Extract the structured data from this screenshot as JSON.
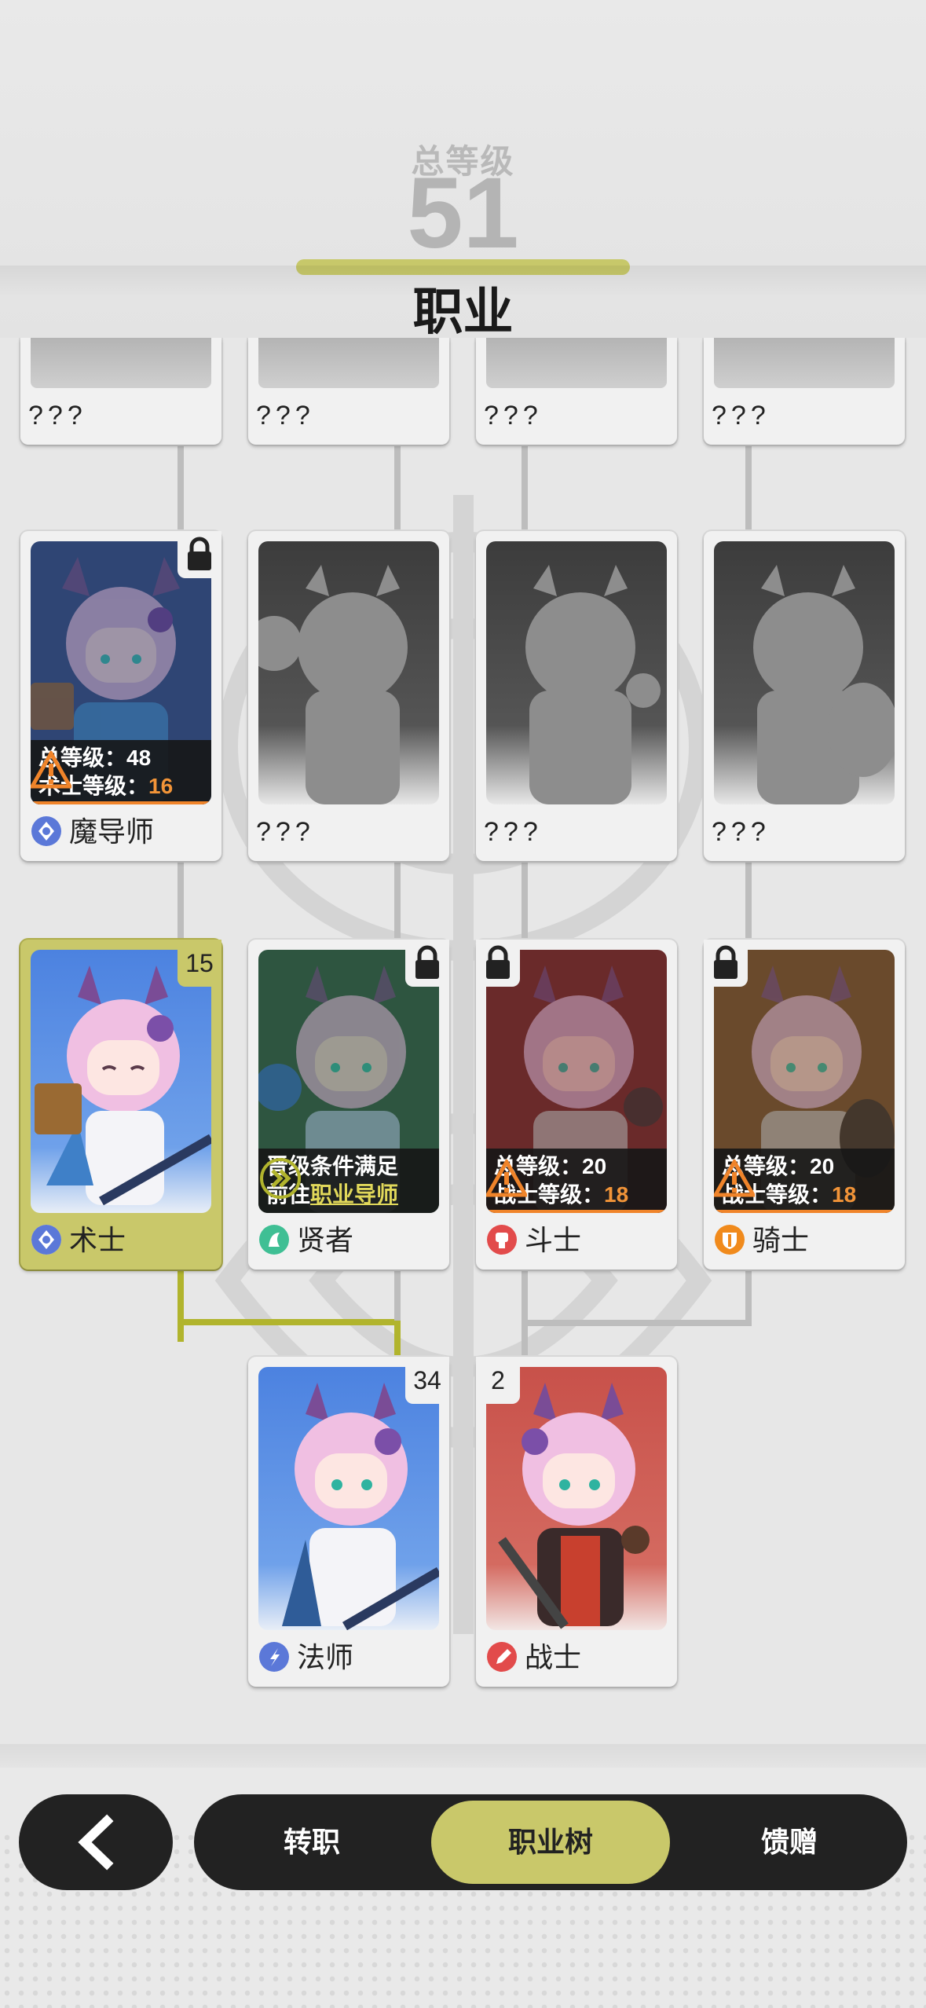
{
  "header": {
    "total_level_label": "总等级",
    "total_level_value": "51",
    "title": "职业"
  },
  "tree": {
    "top_row": [
      {
        "name": "???"
      },
      {
        "name": "???"
      },
      {
        "name": "???"
      },
      {
        "name": "???"
      }
    ],
    "tier3": [
      {
        "name": "魔导师",
        "icon": "mage-emblem-icon",
        "icon_color": "#5b78d8",
        "locked": true,
        "requirement": {
          "line1_label": "总等级：",
          "line1_value": "48",
          "line2_label": "术士等级：",
          "line2_value": "16"
        }
      },
      {
        "name": "???"
      },
      {
        "name": "???"
      },
      {
        "name": "???"
      }
    ],
    "tier2": [
      {
        "name": "术士",
        "icon": "sorcerer-emblem-icon",
        "icon_color": "#5b78d8",
        "level": "15",
        "selected": true
      },
      {
        "name": "贤者",
        "icon": "sage-emblem-icon",
        "icon_color": "#3fbf94",
        "locked": true,
        "requirement": {
          "line1": "晋级条件满足",
          "line2_prefix": "前往",
          "line2_link": "职业导师"
        }
      },
      {
        "name": "斗士",
        "icon": "fighter-emblem-icon",
        "icon_color": "#e24b4b",
        "locked": true,
        "requirement": {
          "line1_label": "总等级：",
          "line1_value": "20",
          "line2_label": "战士等级：",
          "line2_value": "18"
        }
      },
      {
        "name": "骑士",
        "icon": "knight-emblem-icon",
        "icon_color": "#f08a1c",
        "locked": true,
        "requirement": {
          "line1_label": "总等级：",
          "line1_value": "20",
          "line2_label": "战士等级：",
          "line2_value": "18"
        }
      }
    ],
    "tier1": [
      {
        "name": "法师",
        "icon": "mage-emblem-icon",
        "icon_color": "#5b78d8",
        "level": "34"
      },
      {
        "name": "战士",
        "icon": "warrior-emblem-icon",
        "icon_color": "#e24b4b",
        "level": "2"
      }
    ]
  },
  "colors": {
    "accent": "#c9c86a",
    "warning": "#f0842a",
    "nav_bg": "#222222"
  },
  "nav": {
    "back_icon": "chevron-left-icon",
    "tabs": [
      {
        "label": "转职",
        "active": false
      },
      {
        "label": "职业树",
        "active": true
      },
      {
        "label": "馈赠",
        "active": false
      }
    ]
  }
}
